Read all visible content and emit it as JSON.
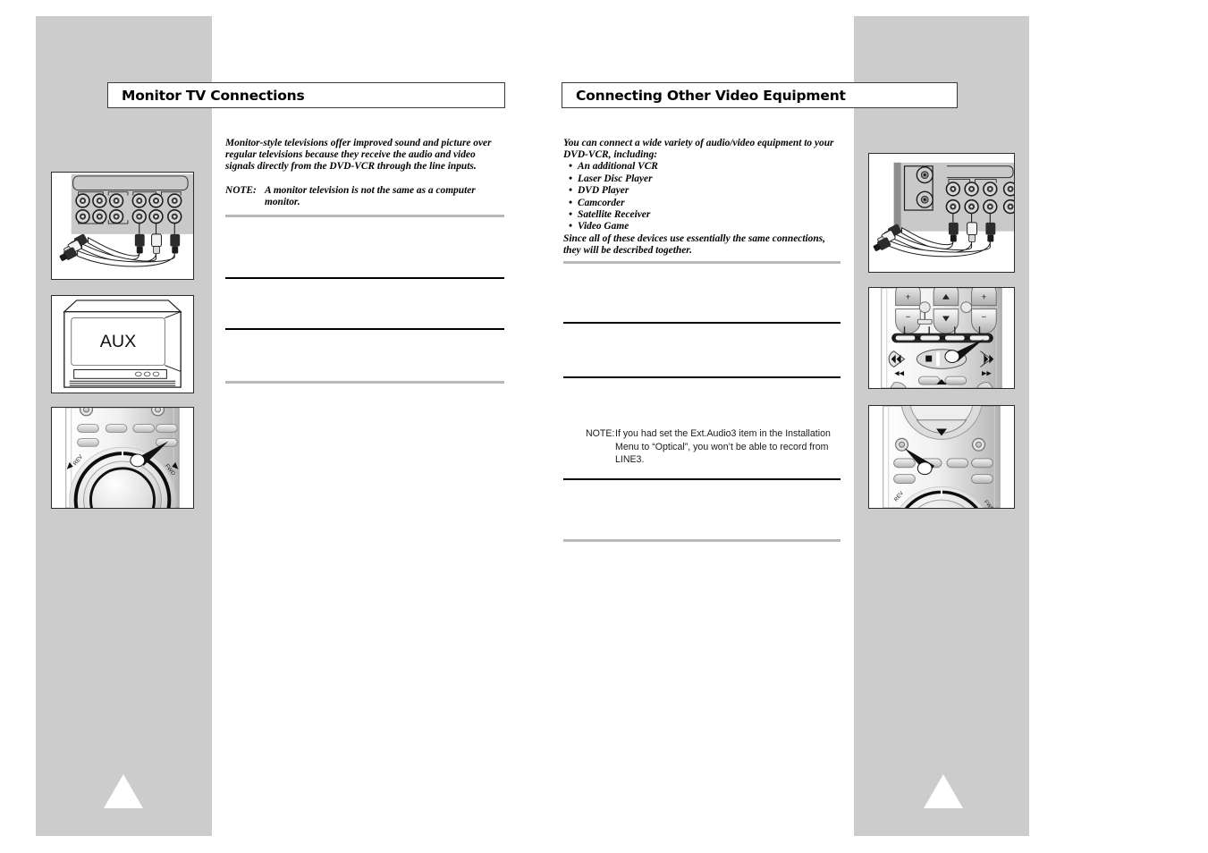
{
  "page": {
    "background": "#ffffff",
    "band_color": "#cccccc",
    "rule_gray": "#b8b8b8",
    "rule_black": "#000000"
  },
  "left_column": {
    "header": "Monitor TV Connections",
    "intro": "Monitor-style televisions offer improved sound and picture over regular televisions because they receive the audio and video signals directly from the DVD-VCR through the line inputs.",
    "note_label": "NOTE:",
    "note_text": "A monitor television is not the same as a computer monitor.",
    "figures": [
      {
        "name": "rear-panel-line-input-connections",
        "caption": ""
      },
      {
        "name": "tv-screen-aux-display",
        "screen_text": "AUX"
      },
      {
        "name": "remote-jog-dial-detail",
        "caption": ""
      }
    ]
  },
  "right_column": {
    "header": "Connecting Other Video Equipment",
    "intro": "You can connect a wide variety of audio/video equipment to your DVD-VCR, including:",
    "equipment_list": [
      "An additional VCR",
      "Laser Disc Player",
      "DVD Player",
      "Camcorder",
      "Satellite Receiver",
      "Video Game"
    ],
    "outro": "Since all of these devices use essentially the same connections, they will be described together.",
    "note_label": "NOTE:",
    "note_text": "If you had set the Ext.Audio3 item in the Installation Menu to “Optical”, you won’t be able to record from LINE3.",
    "figures": [
      {
        "name": "rear-panel-other-equipment-connections",
        "caption": ""
      },
      {
        "name": "remote-transport-buttons-detail",
        "caption": ""
      },
      {
        "name": "remote-lower-buttons-detail",
        "caption": ""
      }
    ]
  }
}
